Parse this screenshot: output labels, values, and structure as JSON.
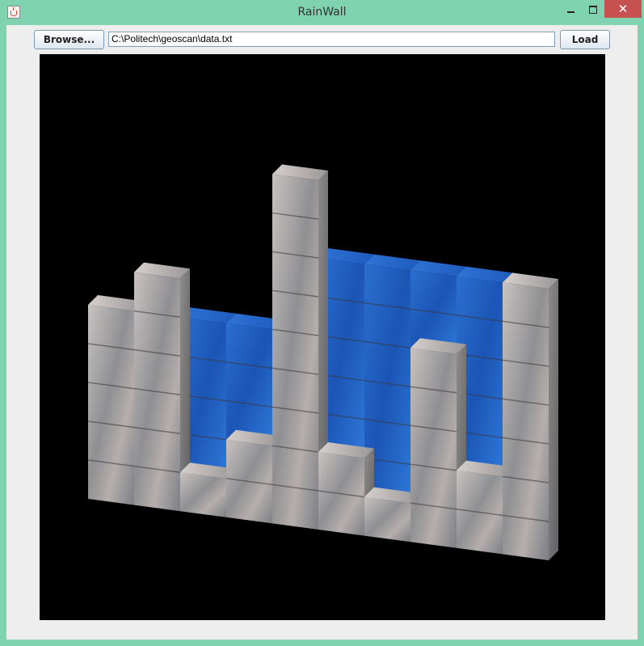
{
  "window": {
    "title": "RainWall",
    "close_glyph": "✕",
    "accent_color": "#7fd3b0"
  },
  "toolbar": {
    "browse_label": "Browse...",
    "file_path": "C:\\Politech\\geoscan\\data.txt",
    "load_label": "Load"
  },
  "scene": {
    "background": "#000000",
    "wall_heights": [
      5,
      6,
      1,
      2,
      9,
      2,
      1,
      5,
      2,
      7
    ],
    "water_levels": [
      0,
      5,
      5,
      5,
      0,
      7,
      7,
      7,
      7,
      0
    ],
    "stone_color": "#a9a7a6",
    "water_color": "#1f63c6"
  }
}
